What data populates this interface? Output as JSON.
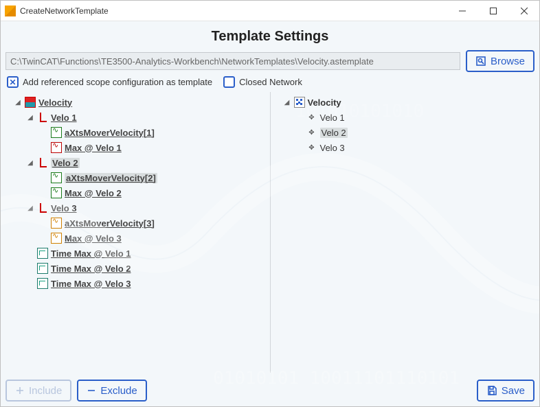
{
  "window_title": "CreateNetworkTemplate",
  "heading": "Template Settings",
  "path": "C:\\TwinCAT\\Functions\\TE3500-Analytics-Workbench\\NetworkTemplates\\Velocity.astemplate",
  "buttons": {
    "browse": "Browse",
    "include": "Include",
    "exclude": "Exclude",
    "save": "Save"
  },
  "checkboxes": {
    "add_scope": {
      "label": "Add referenced scope configuration as template",
      "checked": true
    },
    "closed_net": {
      "label": "Closed Network",
      "checked": false
    }
  },
  "left_tree": {
    "root": "Velocity",
    "groups": [
      {
        "name": "Velo 1",
        "signals": [
          "aXtsMoverVelocity[1]",
          "Max @ Velo 1"
        ],
        "excluded": false
      },
      {
        "name": "Velo 2",
        "signals": [
          "aXtsMoverVelocity[2]",
          "Max @ Velo 2"
        ],
        "excluded": true
      },
      {
        "name": "Velo 3",
        "signals": [
          "aXtsMoverVelocity[3]",
          "Max @ Velo 3"
        ],
        "excluded": false
      }
    ],
    "extras": [
      "Time Max @ Velo 1",
      "Time Max @ Velo 2",
      "Time Max @ Velo 3"
    ]
  },
  "right_tree": {
    "root": "Velocity",
    "items": [
      {
        "name": "Velo 1",
        "selected": false
      },
      {
        "name": "Velo 2",
        "selected": true
      },
      {
        "name": "Velo 3",
        "selected": false
      }
    ]
  }
}
